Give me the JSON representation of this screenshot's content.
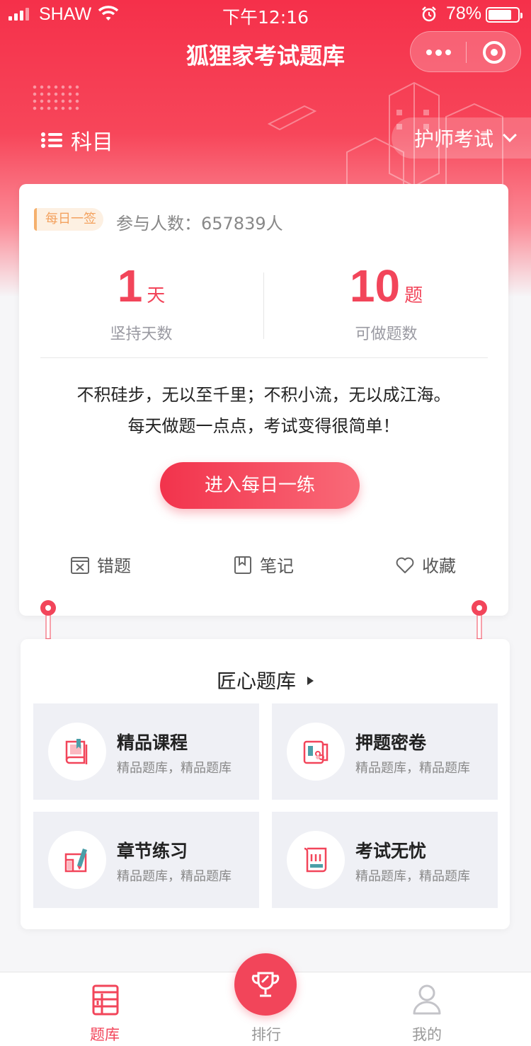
{
  "status_bar": {
    "carrier": "SHAW",
    "time": "下午12:16",
    "battery": "78%"
  },
  "nav": {
    "title": "狐狸家考试题库"
  },
  "header": {
    "subject_label": "科目",
    "exam_select": "护师考试"
  },
  "daily": {
    "badge": "每日一签",
    "participants": "参与人数：657839人",
    "stats": [
      {
        "value": "1",
        "unit": "天",
        "label": "坚持天数"
      },
      {
        "value": "10",
        "unit": "题",
        "label": "可做题数"
      }
    ],
    "quote_line1": "不积硅步，无以至千里；不积小流，无以成江海。",
    "quote_line2": "每天做题一点点，考试变得很简单！",
    "practice_button": "进入每日一练",
    "tools": [
      {
        "label": "错题",
        "icon": "wrong-questions-icon"
      },
      {
        "label": "笔记",
        "icon": "notes-icon"
      },
      {
        "label": "收藏",
        "icon": "heart-icon"
      }
    ]
  },
  "bank": {
    "title": "匠心题库",
    "tiles": [
      {
        "title": "精品课程",
        "subtitle": "精品题库，精品题库",
        "icon": "book-icon"
      },
      {
        "title": "押题密卷",
        "subtitle": "精品题库，精品题库",
        "icon": "scroll-paper-icon"
      },
      {
        "title": "章节练习",
        "subtitle": "精品题库，精品题库",
        "icon": "pen-book-icon"
      },
      {
        "title": "考试无忧",
        "subtitle": "精品题库，精品题库",
        "icon": "certificate-icon"
      }
    ]
  },
  "tabbar": {
    "items": [
      {
        "label": "题库",
        "icon": "question-bank-icon",
        "active": true
      },
      {
        "label": "排行",
        "icon": "trophy-icon",
        "active": false
      },
      {
        "label": "我的",
        "icon": "user-icon",
        "active": false
      }
    ]
  },
  "colors": {
    "accent": "#f2455a",
    "badge_bg": "#fdf0e2",
    "badge_text": "#f3a15e",
    "tile_bg": "#eff0f5"
  }
}
